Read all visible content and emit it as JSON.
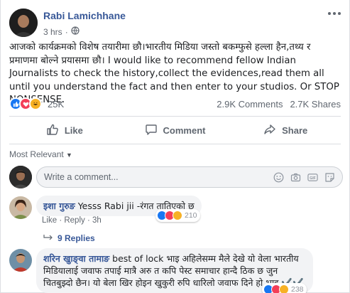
{
  "post": {
    "author": "Rabi Lamichhane",
    "time": "3 hrs",
    "separator": "·",
    "privacy_icon": "globe-icon",
    "text": "आजको कार्यक्रमको विशेष तयारीमा छौ।भारतीय मिडिया जस्तो बकम्फुसे हल्ला हैन,तथ्य र प्रमाणमा बोल्ने प्रयासमा छौ। I would like to recommend fellow Indian Journalists to check the history,collect the evidences,read them all until you understand the fact and then enter to your studios. Or STOP NONSENSE.",
    "reaction_count": "25K",
    "comments_count": "2.9K Comments",
    "shares_count": "2.7K Shares",
    "reactions": [
      "like-icon",
      "love-icon",
      "haha-icon"
    ]
  },
  "actions": {
    "like": "Like",
    "comment": "Comment",
    "share": "Share"
  },
  "comments_section": {
    "filter_label": "Most Relevant",
    "composer_placeholder": "Write a comment...",
    "composer_icons": [
      "smiley-icon",
      "camera-icon",
      "gif-icon",
      "sticker-icon"
    ]
  },
  "comments": [
    {
      "author": "इशा गुरुङ",
      "text": "Yesss Rabi jii -रंगत तातिएको छ",
      "like_label": "Like",
      "reply_label": "Reply",
      "time": "3h",
      "reactions_count": "210",
      "replies_label": "9 Replies"
    },
    {
      "author": "शरिन खुाङ्वा तामाङ",
      "text": "best of lock भाइ अहिलेसम्म मैले देखे यो वेला भारतीय मिडियालाई जवाफ तपाई मात्रै अरु त कपि पेस्ट समाचार हान्दै ठिक छ जुन चितबुझ्दो छैन। यो बेला खिर होइन खुकुरी रुपि धारिलो जवाफ दिने हो भाइ ✔️✔️",
      "reactions_count": "238"
    }
  ],
  "colors": {
    "link_blue": "#385898",
    "like_blue": "#1877f2",
    "love_red": "#f33e58",
    "haha_yellow": "#f7b125",
    "gray_text": "#606770"
  }
}
